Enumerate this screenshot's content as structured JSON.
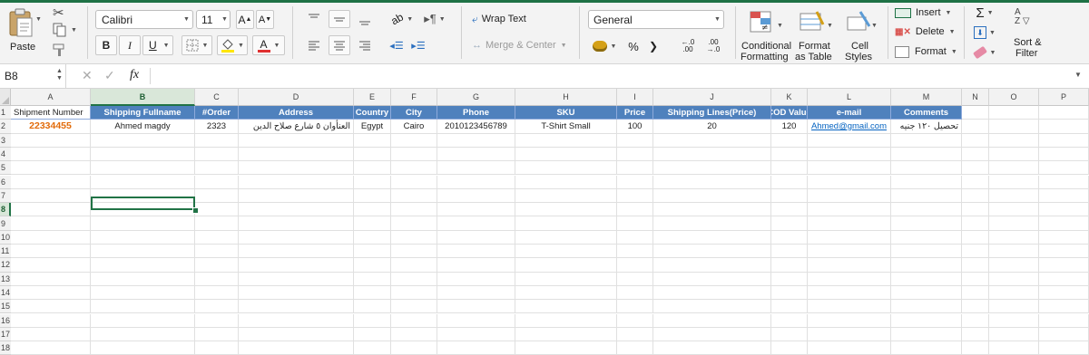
{
  "ribbon": {
    "paste_label": "Paste",
    "font_name": "Calibri",
    "font_size": "11",
    "bold": "B",
    "italic": "I",
    "underline": "U",
    "wrap_text": "Wrap Text",
    "merge_center": "Merge & Center",
    "number_format": "General",
    "percent": "%",
    "comma": "❯",
    "conditional_formatting_l1": "Conditional",
    "conditional_formatting_l2": "Formatting",
    "format_table_l1": "Format",
    "format_table_l2": "as Table",
    "cell_styles_l1": "Cell",
    "cell_styles_l2": "Styles",
    "insert": "Insert",
    "delete": "Delete",
    "format": "Format",
    "sort_filter_l1": "Sort &",
    "sort_filter_l2": "Filter",
    "increase_font": "A",
    "decrease_font": "A",
    "font_color_letter": "A",
    "sigma": "Σ",
    "az": "A\nZ"
  },
  "formula_bar": {
    "name_box": "B8",
    "fx": "fx",
    "value": ""
  },
  "columns": [
    "A",
    "B",
    "C",
    "D",
    "E",
    "F",
    "G",
    "H",
    "I",
    "J",
    "K",
    "L",
    "M",
    "N",
    "O",
    "P"
  ],
  "rows": [
    "1",
    "2",
    "3",
    "4",
    "5",
    "6",
    "7",
    "8",
    "9",
    "10",
    "11",
    "12",
    "13",
    "14",
    "15",
    "16",
    "17",
    "18"
  ],
  "headers": [
    "Shipment Number",
    "Shipping Fullname",
    "#Order",
    "Address",
    "Country",
    "City",
    "Phone",
    "SKU",
    "Price",
    "Shipping Lines(Price)",
    "COD Value",
    "e-mail",
    "Comments"
  ],
  "record": [
    "22334455",
    "Ahmed magdy",
    "2323",
    "العنأوان ٥ شارع صلاح الدين",
    "Egypt",
    "Cairo",
    "2010123456789",
    "T-Shirt Small",
    "100",
    "20",
    "120",
    "Ahmed@gmail.com",
    "تحصيل ١٢٠ جنيه"
  ],
  "colors": {
    "header_fill": "#4f81bd",
    "accent_green": "#217346",
    "shipment_number": "#e26b0a",
    "link": "#0563c1"
  },
  "selected_cell": "B8"
}
